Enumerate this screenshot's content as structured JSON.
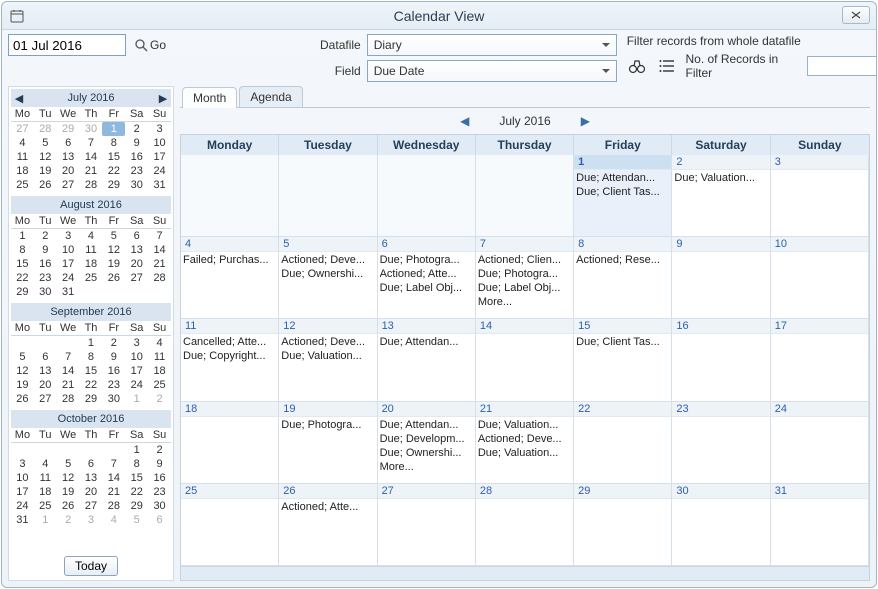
{
  "window": {
    "title": "Calendar View"
  },
  "dateInput": {
    "value": "01 Jul 2016",
    "goLabel": "Go"
  },
  "controls": {
    "datafileLabel": "Datafile",
    "datafileValue": "Diary",
    "fieldLabel": "Field",
    "fieldValue": "Due Date"
  },
  "filter": {
    "title": "Filter records from whole datafile",
    "countLabel": "No. of Records in Filter",
    "countValue": ""
  },
  "tabs": {
    "month": "Month",
    "agenda": "Agenda"
  },
  "monthLabel": "July 2016",
  "weekdays": [
    "Monday",
    "Tuesday",
    "Wednesday",
    "Thursday",
    "Friday",
    "Saturday",
    "Sunday"
  ],
  "miniWeekdays": [
    "Mo",
    "Tu",
    "We",
    "Th",
    "Fr",
    "Sa",
    "Su"
  ],
  "todayLabel": "Today",
  "miniCals": [
    {
      "title": "July 2016",
      "nav": true,
      "lead": [
        27,
        28,
        29,
        30
      ],
      "days": 31,
      "trail": [],
      "sel": 1
    },
    {
      "title": "August 2016",
      "nav": false,
      "lead": [],
      "days": 31,
      "trail": [],
      "sel": null
    },
    {
      "title": "September 2016",
      "nav": false,
      "lead": [
        null,
        null,
        null
      ],
      "days": 30,
      "trail": [
        1,
        2
      ],
      "sel": null
    },
    {
      "title": "October 2016",
      "nav": false,
      "lead": [
        null,
        null,
        null,
        null,
        null
      ],
      "days": 31,
      "trail": [
        1,
        2,
        3,
        4,
        5,
        6
      ],
      "sel": null
    }
  ],
  "cells": [
    {
      "blank": true
    },
    {
      "blank": true
    },
    {
      "blank": true
    },
    {
      "blank": true
    },
    {
      "n": "1",
      "today": true,
      "ev": [
        "Due; Attendan...",
        "Due; Client Tas..."
      ]
    },
    {
      "n": "2",
      "ev": [
        "Due; Valuation..."
      ]
    },
    {
      "n": "3",
      "ev": []
    },
    {
      "n": "4",
      "ev": [
        "Failed; Purchas..."
      ]
    },
    {
      "n": "5",
      "ev": [
        "Actioned; Deve...",
        "Due; Ownershi..."
      ]
    },
    {
      "n": "6",
      "ev": [
        "Due; Photogra...",
        "Actioned; Atte...",
        "Due; Label Obj..."
      ]
    },
    {
      "n": "7",
      "ev": [
        "Actioned; Clien...",
        "Due; Photogra...",
        "Due; Label Obj...",
        "More..."
      ]
    },
    {
      "n": "8",
      "ev": [
        "Actioned; Rese..."
      ]
    },
    {
      "n": "9",
      "ev": []
    },
    {
      "n": "10",
      "ev": []
    },
    {
      "n": "11",
      "ev": [
        "Cancelled; Atte...",
        "Due; Copyright..."
      ]
    },
    {
      "n": "12",
      "ev": [
        "Actioned; Deve...",
        "Due; Valuation..."
      ]
    },
    {
      "n": "13",
      "ev": [
        "Due; Attendan..."
      ]
    },
    {
      "n": "14",
      "ev": []
    },
    {
      "n": "15",
      "ev": [
        "Due; Client Tas..."
      ]
    },
    {
      "n": "16",
      "ev": []
    },
    {
      "n": "17",
      "ev": []
    },
    {
      "n": "18",
      "ev": []
    },
    {
      "n": "19",
      "ev": [
        "Due; Photogra..."
      ]
    },
    {
      "n": "20",
      "ev": [
        "Due; Attendan...",
        "Due; Developm...",
        "Due; Ownershi...",
        "More..."
      ]
    },
    {
      "n": "21",
      "ev": [
        "Due; Valuation...",
        "Actioned; Deve...",
        "Due; Valuation..."
      ]
    },
    {
      "n": "22",
      "ev": []
    },
    {
      "n": "23",
      "ev": []
    },
    {
      "n": "24",
      "ev": []
    },
    {
      "n": "25",
      "ev": []
    },
    {
      "n": "26",
      "ev": [
        "Actioned; Atte..."
      ]
    },
    {
      "n": "27",
      "ev": []
    },
    {
      "n": "28",
      "ev": []
    },
    {
      "n": "29",
      "ev": []
    },
    {
      "n": "30",
      "ev": []
    },
    {
      "n": "31",
      "ev": []
    }
  ]
}
